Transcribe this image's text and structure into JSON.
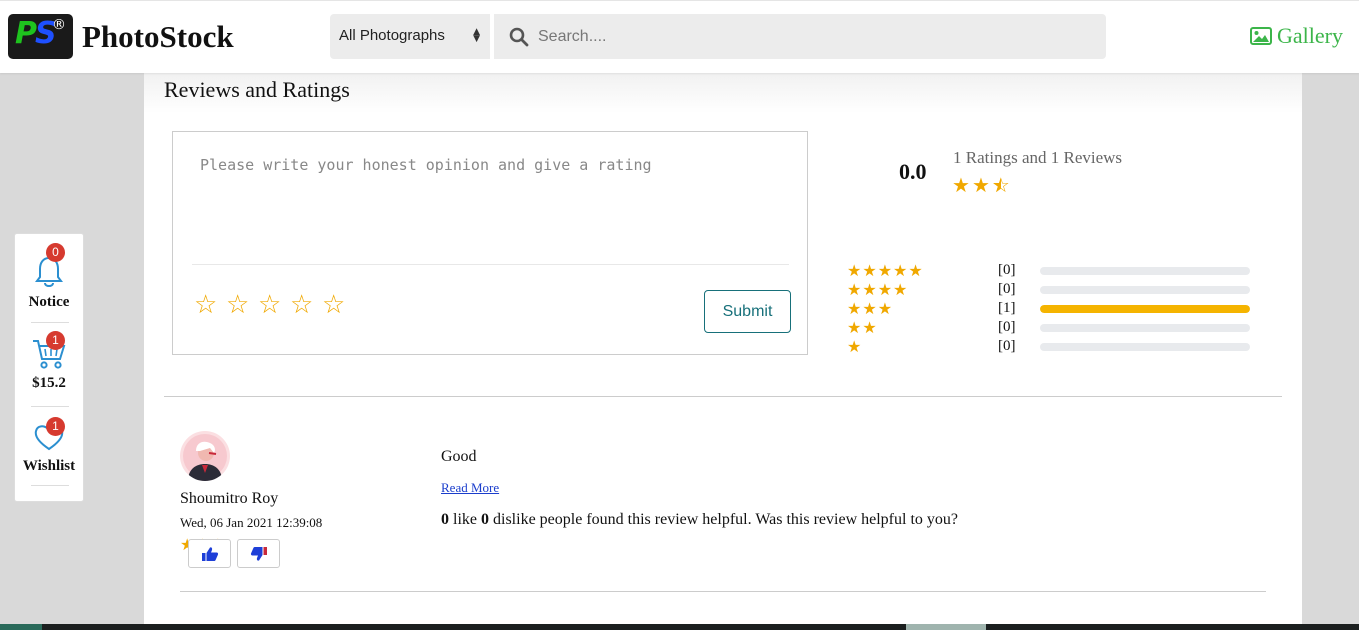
{
  "header": {
    "logo_letter_1": "P",
    "logo_letter_2": "S",
    "logo_reg": "®",
    "brand": "PhotoStock",
    "category_select": "All Photographs",
    "search_placeholder": "Search....",
    "gallery_label": "Gallery"
  },
  "side_panel": {
    "notice": {
      "label": "Notice",
      "badge": "0"
    },
    "cart": {
      "label": "$15.2",
      "badge": "1"
    },
    "wishlist": {
      "label": "Wishlist",
      "badge": "1"
    }
  },
  "reviews": {
    "title": "Reviews and Ratings",
    "form": {
      "placeholder": "Please write your honest opinion and give a rating",
      "empty_star": "☆",
      "submit_label": "Submit"
    },
    "summary": {
      "average": "0.0",
      "text": "1 Ratings and 1 Reviews",
      "stars_shown": 2.5
    },
    "breakdown": [
      {
        "stars": "★★★★★",
        "count": "[0]",
        "fraction": 0
      },
      {
        "stars": "★★★★",
        "count": "[0]",
        "fraction": 0
      },
      {
        "stars": "★★★",
        "count": "[1]",
        "fraction": 1
      },
      {
        "stars": "★★",
        "count": "[0]",
        "fraction": 0
      },
      {
        "stars": "★",
        "count": "[0]",
        "fraction": 0
      }
    ],
    "items": [
      {
        "name": "Shoumitro Roy",
        "date": "Wed, 06 Jan 2021 12:39:08",
        "stars": "★★★",
        "text": "Good",
        "read_more": "Read More",
        "likes": "0",
        "like_word": "like",
        "dislikes": "0",
        "helpful_text": "dislike people found this review helpful. Was this review helpful to you?"
      }
    ]
  },
  "colors": {
    "star": "#f0a800",
    "bar_fill": "#f5b400",
    "gallery": "#3cb54a",
    "badge": "#d63a2f",
    "submit": "#17707a",
    "thumb": "#1e3fd8"
  },
  "icons": {
    "search": "search-icon",
    "gallery": "image-icon",
    "notice": "bell-icon",
    "cart": "cart-icon",
    "wishlist": "heart-icon",
    "like": "thumbs-up-icon",
    "dislike": "thumbs-down-icon"
  }
}
